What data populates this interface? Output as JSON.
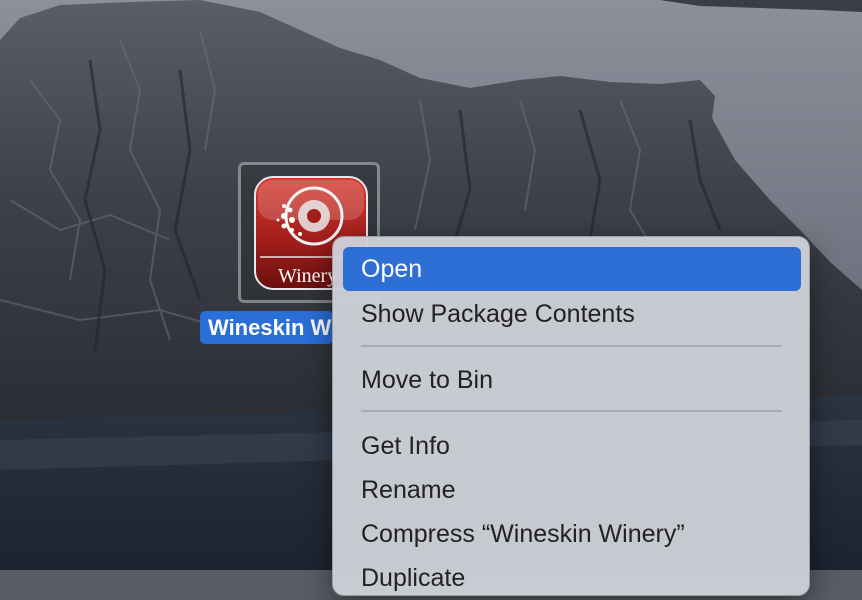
{
  "desktop": {
    "icon_label": "Wineskin W",
    "icon_text": "Winery"
  },
  "context_menu": {
    "items": [
      {
        "label": "Open",
        "selected": true
      },
      {
        "label": "Show Package Contents"
      },
      {
        "label": "Move to Bin"
      },
      {
        "label": "Get Info"
      },
      {
        "label": "Rename"
      },
      {
        "label": "Compress “Wineskin Winery”"
      },
      {
        "label": "Duplicate"
      }
    ]
  },
  "colors": {
    "selection": "#2d6fd4",
    "label_highlight": "#2a6ed8"
  }
}
